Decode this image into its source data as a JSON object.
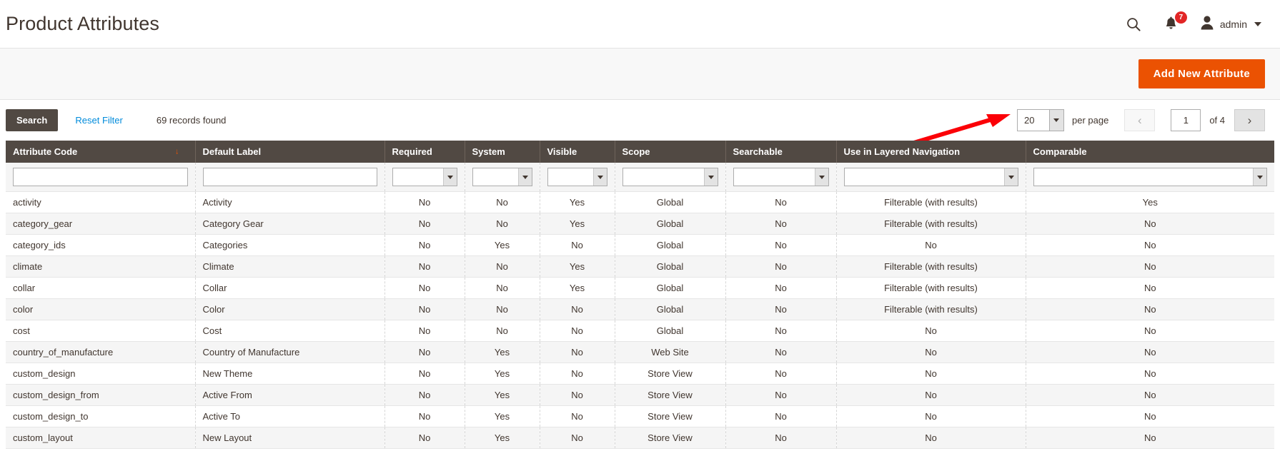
{
  "header": {
    "title": "Product Attributes",
    "search_icon": "search-icon",
    "notifications_icon": "bell-icon",
    "notifications_count": "7",
    "user_icon": "user-avatar-icon",
    "user_name": "admin",
    "caret_icon": "chevron-down-icon"
  },
  "actionbar": {
    "add_new_attribute": "Add New Attribute",
    "accent_color": "#eb5202",
    "annotation": "red-arrow-pointing-to-add-new-attribute"
  },
  "toolbar": {
    "search_label": "Search",
    "reset_filter_label": "Reset Filter",
    "records_found": "69 records found",
    "per_page_value": "20",
    "per_page_label": "per page",
    "prev_icon": "chevron-left-icon",
    "next_icon": "chevron-right-icon",
    "page_value": "1",
    "of_label": "of 4"
  },
  "grid": {
    "columns": [
      {
        "label": "Attribute Code",
        "key": "code",
        "filter": "text",
        "sorted": true,
        "sort_dir": "asc",
        "align": "left"
      },
      {
        "label": "Default Label",
        "key": "label",
        "filter": "text",
        "align": "left"
      },
      {
        "label": "Required",
        "key": "required",
        "filter": "select",
        "align": "center"
      },
      {
        "label": "System",
        "key": "system",
        "filter": "select",
        "align": "center"
      },
      {
        "label": "Visible",
        "key": "visible",
        "filter": "select",
        "align": "center"
      },
      {
        "label": "Scope",
        "key": "scope",
        "filter": "select",
        "align": "center"
      },
      {
        "label": "Searchable",
        "key": "searchable",
        "filter": "select",
        "align": "center"
      },
      {
        "label": "Use in Layered Navigation",
        "key": "layered",
        "filter": "select",
        "align": "center"
      },
      {
        "label": "Comparable",
        "key": "comparable",
        "filter": "select",
        "align": "center"
      }
    ],
    "filters": {
      "code": "",
      "label": "",
      "required": "",
      "system": "",
      "visible": "",
      "scope": "",
      "searchable": "",
      "layered": "",
      "comparable": ""
    },
    "rows": [
      {
        "code": "activity",
        "label": "Activity",
        "required": "No",
        "system": "No",
        "visible": "Yes",
        "scope": "Global",
        "searchable": "No",
        "layered": "Filterable (with results)",
        "comparable": "Yes"
      },
      {
        "code": "category_gear",
        "label": "Category Gear",
        "required": "No",
        "system": "No",
        "visible": "Yes",
        "scope": "Global",
        "searchable": "No",
        "layered": "Filterable (with results)",
        "comparable": "No"
      },
      {
        "code": "category_ids",
        "label": "Categories",
        "required": "No",
        "system": "Yes",
        "visible": "No",
        "scope": "Global",
        "searchable": "No",
        "layered": "No",
        "comparable": "No"
      },
      {
        "code": "climate",
        "label": "Climate",
        "required": "No",
        "system": "No",
        "visible": "Yes",
        "scope": "Global",
        "searchable": "No",
        "layered": "Filterable (with results)",
        "comparable": "No"
      },
      {
        "code": "collar",
        "label": "Collar",
        "required": "No",
        "system": "No",
        "visible": "Yes",
        "scope": "Global",
        "searchable": "No",
        "layered": "Filterable (with results)",
        "comparable": "No"
      },
      {
        "code": "color",
        "label": "Color",
        "required": "No",
        "system": "No",
        "visible": "No",
        "scope": "Global",
        "searchable": "No",
        "layered": "Filterable (with results)",
        "comparable": "No"
      },
      {
        "code": "cost",
        "label": "Cost",
        "required": "No",
        "system": "No",
        "visible": "No",
        "scope": "Global",
        "searchable": "No",
        "layered": "No",
        "comparable": "No"
      },
      {
        "code": "country_of_manufacture",
        "label": "Country of Manufacture",
        "required": "No",
        "system": "Yes",
        "visible": "No",
        "scope": "Web Site",
        "searchable": "No",
        "layered": "No",
        "comparable": "No"
      },
      {
        "code": "custom_design",
        "label": "New Theme",
        "required": "No",
        "system": "Yes",
        "visible": "No",
        "scope": "Store View",
        "searchable": "No",
        "layered": "No",
        "comparable": "No"
      },
      {
        "code": "custom_design_from",
        "label": "Active From",
        "required": "No",
        "system": "Yes",
        "visible": "No",
        "scope": "Store View",
        "searchable": "No",
        "layered": "No",
        "comparable": "No"
      },
      {
        "code": "custom_design_to",
        "label": "Active To",
        "required": "No",
        "system": "Yes",
        "visible": "No",
        "scope": "Store View",
        "searchable": "No",
        "layered": "No",
        "comparable": "No"
      },
      {
        "code": "custom_layout",
        "label": "New Layout",
        "required": "No",
        "system": "Yes",
        "visible": "No",
        "scope": "Store View",
        "searchable": "No",
        "layered": "No",
        "comparable": "No"
      }
    ]
  }
}
